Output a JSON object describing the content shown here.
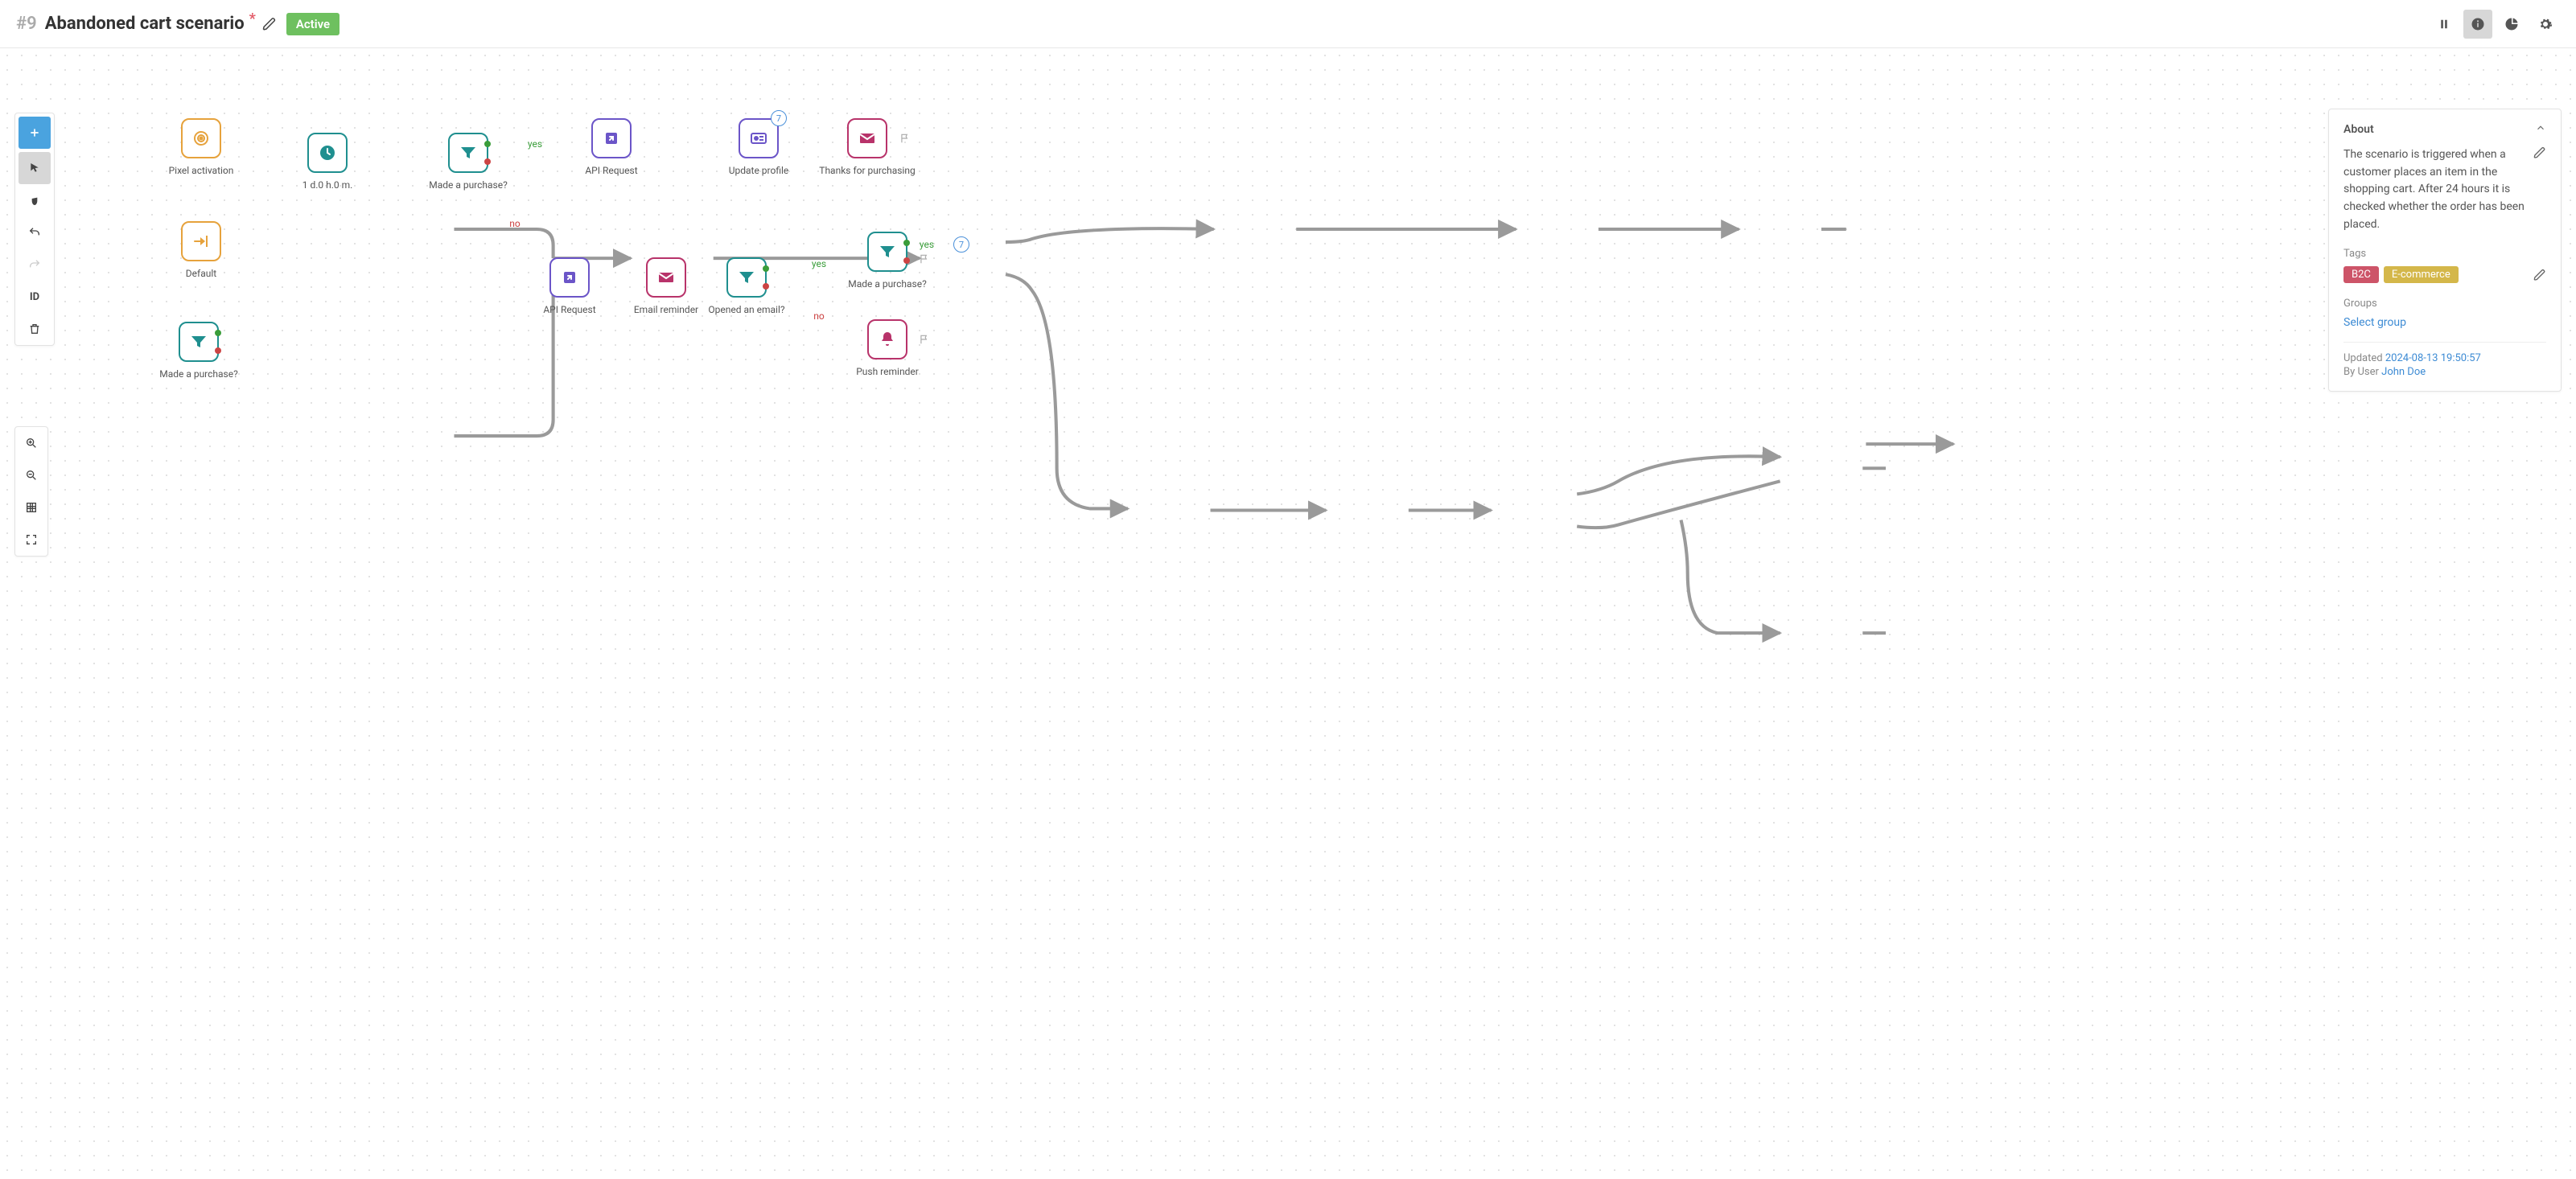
{
  "header": {
    "id_prefix": "#9",
    "title": "Abandoned cart scenario",
    "unsaved_marker": "*",
    "status_label": "Active"
  },
  "nodes": {
    "pixel_activation": {
      "label": "Pixel activation"
    },
    "default_trigger": {
      "label": "Default"
    },
    "delay": {
      "label": "1 d.0 h.0 m."
    },
    "filter_main": {
      "label": "Made a purchase?"
    },
    "api_top": {
      "label": "API Request"
    },
    "update_profile": {
      "label": "Update profile",
      "badge": "7"
    },
    "thanks_email": {
      "label": "Thanks for purchasing"
    },
    "api_bottom": {
      "label": "API Request"
    },
    "email_reminder": {
      "label": "Email reminder"
    },
    "opened_filter": {
      "label": "Opened an email?"
    },
    "filter_right": {
      "label": "Made a purchase?"
    },
    "push_reminder": {
      "label": "Push reminder"
    },
    "orphan_filter": {
      "label": "Made a purchase?"
    },
    "goto_ref": {
      "label": "7"
    }
  },
  "edges": {
    "filter_main_yes": "yes",
    "filter_main_no": "no",
    "opened_yes": "yes",
    "filter_right_yes": "yes",
    "filter_right_no": "no"
  },
  "tools": {
    "id_label": "ID"
  },
  "about": {
    "heading": "About",
    "description": "The scenario is triggered when a customer places an item in the shopping cart. After 24 hours it is checked whether the order has been placed.",
    "tags_heading": "Tags",
    "tags": {
      "b2c": "B2C",
      "ecom": "E-commerce"
    },
    "groups_heading": "Groups",
    "groups_select": "Select group",
    "updated_label": "Updated ",
    "updated_value": "2024-08-13 19:50:57",
    "byuser_label": "By User ",
    "byuser_value": "John Doe"
  }
}
